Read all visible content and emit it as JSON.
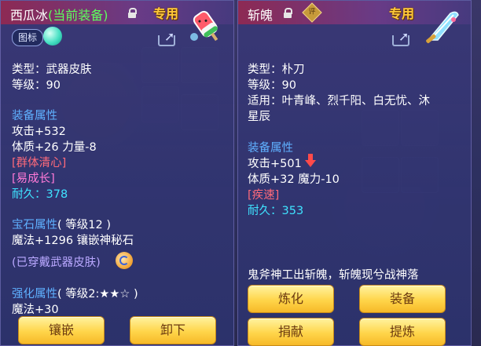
{
  "left": {
    "title_name": "西瓜冰",
    "title_status": "(当前装备)",
    "tag": "专用",
    "badge_label": "图标",
    "type_line": "类型：武器皮肤",
    "level_line": "等级：90",
    "equip_attr_header": "装备属性",
    "attack_line": "攻击+532",
    "body_line": "体质+26 力量-8",
    "skill1": "[群体清心]",
    "skill2": "[易成长]",
    "durability_label": "耐久：",
    "durability_value": "378",
    "gem_header": "宝石属性",
    "gem_level": "( 等级12 )",
    "gem_line": "魔法+1296 镶嵌神秘石",
    "worn_note": "(已穿戴武器皮肤)",
    "enhance_header": "强化属性",
    "enhance_level": "( 等级2:★★☆ )",
    "magic_line": "魔法+30",
    "buttons": [
      "镶嵌",
      "卸下"
    ]
  },
  "right": {
    "title_name": "斩魄",
    "seal_text": "评",
    "tag": "专用",
    "type_line": "类型：朴刀",
    "level_line": "等级：90",
    "suitable_line1": "适用：叶青峰、烈千阳、白无忧、沐",
    "suitable_line2": "星辰",
    "equip_attr_header": "装备属性",
    "attack_line": "攻击+501",
    "body_line": "体质+32 魔力-10",
    "skill1": "[疾速]",
    "durability_label": "耐久：",
    "durability_value": "353",
    "flavor": "鬼斧神工出斩魄，斩魄现兮战神落",
    "buttons": [
      "炼化",
      "装备",
      "捐献",
      "提炼"
    ]
  },
  "colors": {
    "green_status": "#5dff5d",
    "section_blue": "#5fb0ff",
    "skill_red": "#ff6a7a",
    "skill_pink": "#ff7ad8",
    "durability_cyan": "#3fe3ff",
    "tag_gold": "#ffc93a",
    "button_gold": "#ffd54a"
  },
  "icons": [
    "lock-icon",
    "share-icon",
    "watermelon-ice-icon",
    "blade-weapon-icon",
    "teal-orb-icon",
    "refresh-icon",
    "down-arrow-icon",
    "seal-icon"
  ]
}
